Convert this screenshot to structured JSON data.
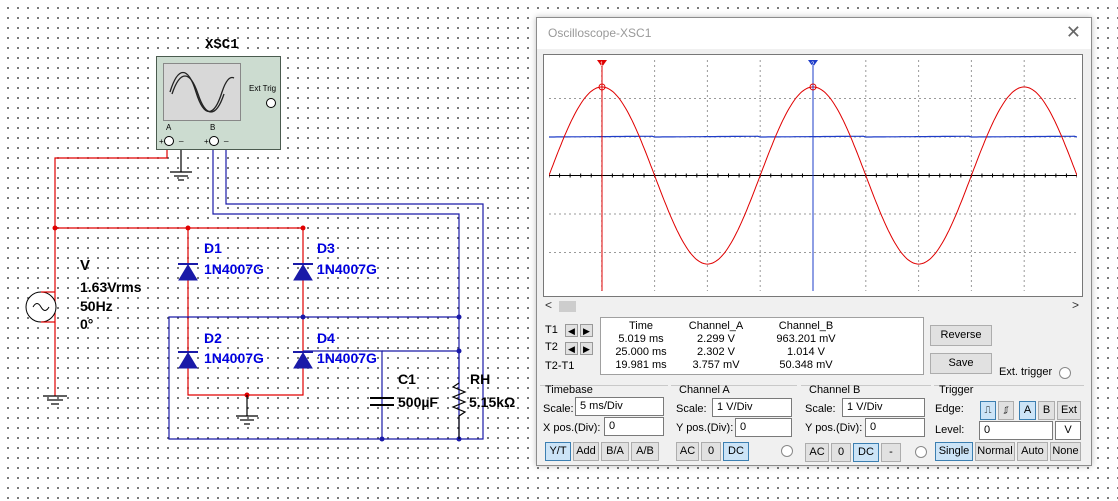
{
  "schematic": {
    "scope_ref": "XSC1",
    "scope_ext_trig": "Ext Trig",
    "scope_terminals": {
      "a": "A",
      "b": "B",
      "plus": "+",
      "minus": "_"
    },
    "source": {
      "name": "V",
      "voltage": "1.63Vrms",
      "frequency": "50Hz",
      "phase": "0°"
    },
    "d1": {
      "ref": "D1",
      "model": "1N4007G"
    },
    "d2": {
      "ref": "D2",
      "model": "1N4007G"
    },
    "d3": {
      "ref": "D3",
      "model": "1N4007G"
    },
    "d4": {
      "ref": "D4",
      "model": "1N4007G"
    },
    "cap": {
      "ref": "C1",
      "value": "500µF"
    },
    "res": {
      "ref": "RH",
      "value": "5.15kΩ"
    }
  },
  "oscilloscope": {
    "title": "Oscilloscope-XSC1",
    "close_icon": "close-icon",
    "colors": {
      "channel_a": "#e00000",
      "channel_b": "#1e3cc8",
      "cursor_t1": "#e00000",
      "cursor_t2": "#1e3cc8"
    },
    "cursor_labels": {
      "t1": "1",
      "t2": "2"
    },
    "plot": {
      "channel_a_amplitude_v": 2.3,
      "channel_a_period_ms": 20,
      "channel_b_level_v": 1.0,
      "channel_b_ripple_v": 0.05,
      "visible_time_ms": 50,
      "volts_per_div": 1,
      "ms_per_div": 5,
      "cursor_t1_ms": 5.019,
      "cursor_t2_ms": 25.0
    },
    "measurement": {
      "headers": [
        "Time",
        "Channel_A",
        "Channel_B"
      ],
      "rows": [
        {
          "label": "T1",
          "time": "5.019 ms",
          "channel_a": "2.299 V",
          "channel_b": "963.201 mV"
        },
        {
          "label": "T2",
          "time": "25.000 ms",
          "channel_a": "2.302 V",
          "channel_b": "1.014 V"
        },
        {
          "label": "T2-T1",
          "time": "19.981 ms",
          "channel_a": "3.757 mV",
          "channel_b": "50.348 mV"
        }
      ]
    },
    "buttons": {
      "reverse": "Reverse",
      "save": "Save",
      "ext_trigger": "Ext. trigger"
    },
    "timebase": {
      "title": "Timebase",
      "scale_label": "Scale:",
      "scale": "5 ms/Div",
      "xpos_label": "X pos.(Div):",
      "xpos": "0",
      "modes": [
        "Y/T",
        "Add",
        "B/A",
        "A/B"
      ],
      "selected_mode": "Y/T"
    },
    "channel_a": {
      "title": "Channel A",
      "scale_label": "Scale:",
      "scale": "1  V/Div",
      "ypos_label": "Y pos.(Div):",
      "ypos": "0",
      "coupling": [
        "AC",
        "0",
        "DC"
      ],
      "selected_coupling": "DC"
    },
    "channel_b": {
      "title": "Channel B",
      "scale_label": "Scale:",
      "scale": "1  V/Div",
      "ypos_label": "Y pos.(Div):",
      "ypos": "0",
      "coupling": [
        "AC",
        "0",
        "DC",
        "-"
      ],
      "selected_coupling": "DC"
    },
    "trigger": {
      "title": "Trigger",
      "edge_label": "Edge:",
      "edge_sources": [
        "A",
        "B",
        "Ext"
      ],
      "selected_source": "A",
      "level_label": "Level:",
      "level": "0",
      "level_unit": "V",
      "modes": [
        "Single",
        "Normal",
        "Auto",
        "None"
      ],
      "selected_mode": "Single"
    }
  }
}
